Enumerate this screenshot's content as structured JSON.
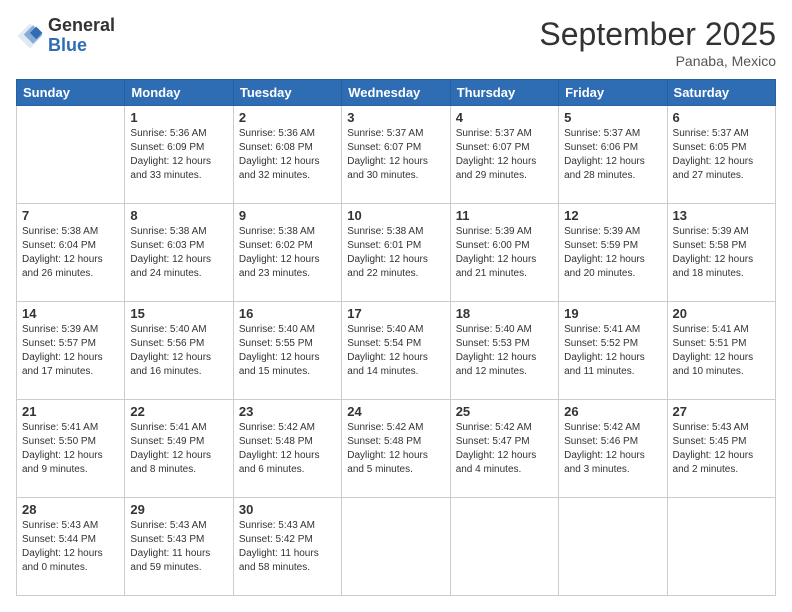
{
  "logo": {
    "general": "General",
    "blue": "Blue"
  },
  "header": {
    "month": "September 2025",
    "location": "Panaba, Mexico"
  },
  "days_of_week": [
    "Sunday",
    "Monday",
    "Tuesday",
    "Wednesday",
    "Thursday",
    "Friday",
    "Saturday"
  ],
  "weeks": [
    [
      {
        "day": "",
        "info": ""
      },
      {
        "day": "1",
        "info": "Sunrise: 5:36 AM\nSunset: 6:09 PM\nDaylight: 12 hours\nand 33 minutes."
      },
      {
        "day": "2",
        "info": "Sunrise: 5:36 AM\nSunset: 6:08 PM\nDaylight: 12 hours\nand 32 minutes."
      },
      {
        "day": "3",
        "info": "Sunrise: 5:37 AM\nSunset: 6:07 PM\nDaylight: 12 hours\nand 30 minutes."
      },
      {
        "day": "4",
        "info": "Sunrise: 5:37 AM\nSunset: 6:07 PM\nDaylight: 12 hours\nand 29 minutes."
      },
      {
        "day": "5",
        "info": "Sunrise: 5:37 AM\nSunset: 6:06 PM\nDaylight: 12 hours\nand 28 minutes."
      },
      {
        "day": "6",
        "info": "Sunrise: 5:37 AM\nSunset: 6:05 PM\nDaylight: 12 hours\nand 27 minutes."
      }
    ],
    [
      {
        "day": "7",
        "info": "Sunrise: 5:38 AM\nSunset: 6:04 PM\nDaylight: 12 hours\nand 26 minutes."
      },
      {
        "day": "8",
        "info": "Sunrise: 5:38 AM\nSunset: 6:03 PM\nDaylight: 12 hours\nand 24 minutes."
      },
      {
        "day": "9",
        "info": "Sunrise: 5:38 AM\nSunset: 6:02 PM\nDaylight: 12 hours\nand 23 minutes."
      },
      {
        "day": "10",
        "info": "Sunrise: 5:38 AM\nSunset: 6:01 PM\nDaylight: 12 hours\nand 22 minutes."
      },
      {
        "day": "11",
        "info": "Sunrise: 5:39 AM\nSunset: 6:00 PM\nDaylight: 12 hours\nand 21 minutes."
      },
      {
        "day": "12",
        "info": "Sunrise: 5:39 AM\nSunset: 5:59 PM\nDaylight: 12 hours\nand 20 minutes."
      },
      {
        "day": "13",
        "info": "Sunrise: 5:39 AM\nSunset: 5:58 PM\nDaylight: 12 hours\nand 18 minutes."
      }
    ],
    [
      {
        "day": "14",
        "info": "Sunrise: 5:39 AM\nSunset: 5:57 PM\nDaylight: 12 hours\nand 17 minutes."
      },
      {
        "day": "15",
        "info": "Sunrise: 5:40 AM\nSunset: 5:56 PM\nDaylight: 12 hours\nand 16 minutes."
      },
      {
        "day": "16",
        "info": "Sunrise: 5:40 AM\nSunset: 5:55 PM\nDaylight: 12 hours\nand 15 minutes."
      },
      {
        "day": "17",
        "info": "Sunrise: 5:40 AM\nSunset: 5:54 PM\nDaylight: 12 hours\nand 14 minutes."
      },
      {
        "day": "18",
        "info": "Sunrise: 5:40 AM\nSunset: 5:53 PM\nDaylight: 12 hours\nand 12 minutes."
      },
      {
        "day": "19",
        "info": "Sunrise: 5:41 AM\nSunset: 5:52 PM\nDaylight: 12 hours\nand 11 minutes."
      },
      {
        "day": "20",
        "info": "Sunrise: 5:41 AM\nSunset: 5:51 PM\nDaylight: 12 hours\nand 10 minutes."
      }
    ],
    [
      {
        "day": "21",
        "info": "Sunrise: 5:41 AM\nSunset: 5:50 PM\nDaylight: 12 hours\nand 9 minutes."
      },
      {
        "day": "22",
        "info": "Sunrise: 5:41 AM\nSunset: 5:49 PM\nDaylight: 12 hours\nand 8 minutes."
      },
      {
        "day": "23",
        "info": "Sunrise: 5:42 AM\nSunset: 5:48 PM\nDaylight: 12 hours\nand 6 minutes."
      },
      {
        "day": "24",
        "info": "Sunrise: 5:42 AM\nSunset: 5:48 PM\nDaylight: 12 hours\nand 5 minutes."
      },
      {
        "day": "25",
        "info": "Sunrise: 5:42 AM\nSunset: 5:47 PM\nDaylight: 12 hours\nand 4 minutes."
      },
      {
        "day": "26",
        "info": "Sunrise: 5:42 AM\nSunset: 5:46 PM\nDaylight: 12 hours\nand 3 minutes."
      },
      {
        "day": "27",
        "info": "Sunrise: 5:43 AM\nSunset: 5:45 PM\nDaylight: 12 hours\nand 2 minutes."
      }
    ],
    [
      {
        "day": "28",
        "info": "Sunrise: 5:43 AM\nSunset: 5:44 PM\nDaylight: 12 hours\nand 0 minutes."
      },
      {
        "day": "29",
        "info": "Sunrise: 5:43 AM\nSunset: 5:43 PM\nDaylight: 11 hours\nand 59 minutes."
      },
      {
        "day": "30",
        "info": "Sunrise: 5:43 AM\nSunset: 5:42 PM\nDaylight: 11 hours\nand 58 minutes."
      },
      {
        "day": "",
        "info": ""
      },
      {
        "day": "",
        "info": ""
      },
      {
        "day": "",
        "info": ""
      },
      {
        "day": "",
        "info": ""
      }
    ]
  ]
}
